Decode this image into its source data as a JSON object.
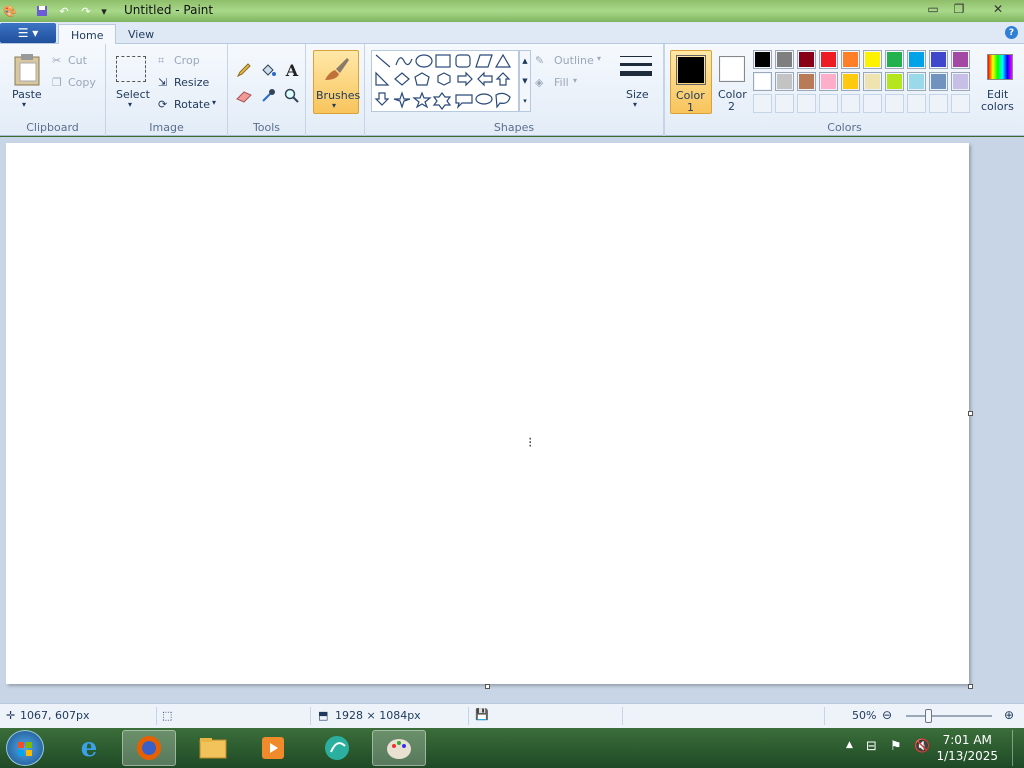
{
  "window": {
    "title": "Untitled - Paint"
  },
  "tabs": [
    {
      "label": "Home",
      "active": true
    },
    {
      "label": "View",
      "active": false
    }
  ],
  "clipboard": {
    "paste": "Paste",
    "cut": "Cut",
    "copy": "Copy",
    "group": "Clipboard"
  },
  "image": {
    "select": "Select",
    "crop": "Crop",
    "resize": "Resize",
    "rotate": "Rotate",
    "group": "Image"
  },
  "tools": {
    "group": "Tools"
  },
  "brushes": {
    "label": "Brushes"
  },
  "shapes": {
    "outline": "Outline",
    "fill": "Fill",
    "group": "Shapes"
  },
  "size": {
    "label": "Size"
  },
  "colors": {
    "color1": "Color 1",
    "color1_a": "Color",
    "color1_b": "1",
    "color2_a": "Color",
    "color2_b": "2",
    "edit_a": "Edit",
    "edit_b": "colors",
    "group": "Colors",
    "color1_value": "#000000",
    "color2_value": "#ffffff",
    "row1": [
      "#000000",
      "#7f7f7f",
      "#880015",
      "#ed1c24",
      "#ff7f27",
      "#fff200",
      "#22b14c",
      "#00a2e8",
      "#3f48cc",
      "#a349a4"
    ],
    "row2": [
      "#ffffff",
      "#c3c3c3",
      "#b97a57",
      "#ffaec9",
      "#ffc90e",
      "#efe4b0",
      "#b5e61d",
      "#99d9ea",
      "#7092be",
      "#c8bfe7"
    ]
  },
  "status": {
    "cursor": "1067, 607px",
    "canvas_size": "1928 × 1084px",
    "zoom": "50%"
  },
  "taskbar": {
    "time": "7:01 AM",
    "date": "1/13/2025"
  }
}
